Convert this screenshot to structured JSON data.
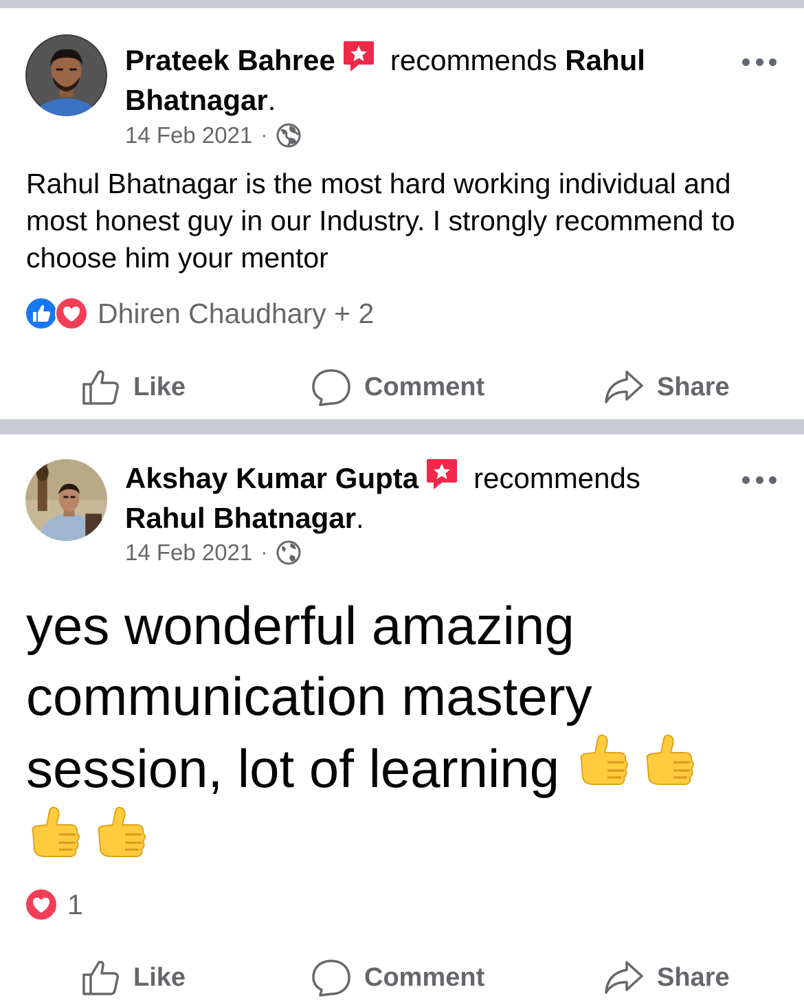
{
  "posts": [
    {
      "author": "Prateek Bahree",
      "action_text": "recommends",
      "target_part1": "Rahul",
      "target_part2": "Bhatnagar",
      "period": ".",
      "date": "14 Feb 2021",
      "separator": "·",
      "privacy_icon": "globe-icon",
      "body": "Rahul Bhatnagar is the most hard working individual and most honest guy in our Industry. I strongly recommend to choose him your mentor",
      "reactions_text": "Dhiren Chaudhary + 2",
      "reaction_icons": [
        "like-reaction-icon",
        "love-reaction-icon"
      ],
      "actions": {
        "like": "Like",
        "comment": "Comment",
        "share": "Share"
      }
    },
    {
      "author": "Akshay Kumar Gupta",
      "action_text": "recommends",
      "target": "Rahul Bhatnagar",
      "period": ".",
      "date": "14 Feb 2021",
      "separator": "·",
      "privacy_icon": "globe-icon",
      "body_line1": "yes wonderful amazing",
      "body_line2": "communication mastery",
      "body_line3": "session,  lot of learning",
      "body_emoji": "thumbs-up-icon",
      "reactions_count": "1",
      "reaction_icons": [
        "love-reaction-icon"
      ],
      "actions": {
        "like": "Like",
        "comment": "Comment",
        "share": "Share"
      }
    }
  ],
  "colors": {
    "divider": "#c9ccd1",
    "secondary_text": "#65676b",
    "like_blue": "#1877f2",
    "love_red": "#f33e58",
    "badge_red": "#f02849"
  }
}
